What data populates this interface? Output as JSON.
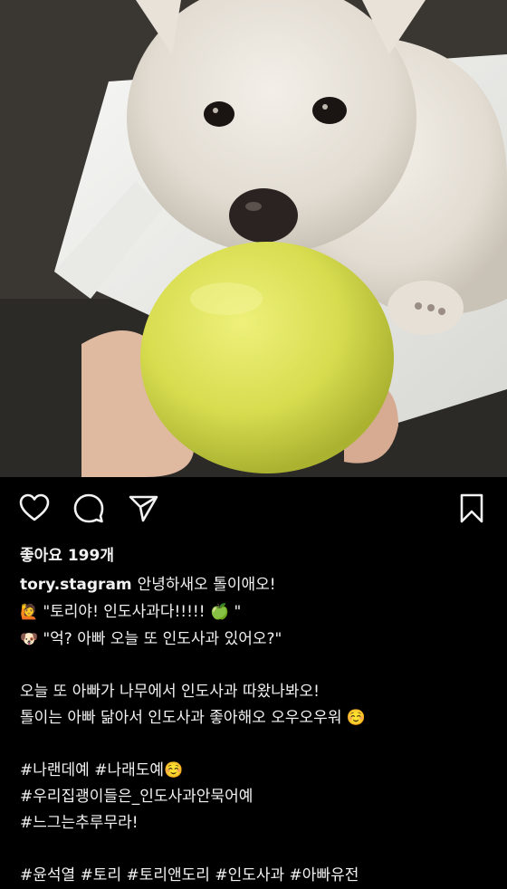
{
  "post": {
    "likes": "좋아요 199개",
    "username": "tory.stagram",
    "caption_lines": [
      {
        "text": "안녕하새오 톨이애오!"
      },
      {
        "emoji": "🙋",
        "text": " \"토리야! 인도사과다!!!!! 🍏 \""
      },
      {
        "emoji": "🐶",
        "text": " \"억? 아빠 오늘 또 인도사과 있어오?\""
      },
      {
        "text": ""
      },
      {
        "text": "오늘 또 아빠가 나무에서 인도사과 따왔나봐오!"
      },
      {
        "text": "톨이는 아빠 닮아서 인도사과 좋아해오 오우오우워 ☺️"
      },
      {
        "text": ""
      }
    ],
    "hashtag_lines": [
      "#나랜데예 #나래도예☺️",
      "#우리집괭이들은_인도사과안묵어예",
      "#느그는추루무라!",
      "",
      "#윤석열 #토리 #토리앤도리 #인도사과 #아빠유전"
    ]
  },
  "icons": {
    "like": "heart-outline-icon",
    "comment": "speech-bubble-icon",
    "share": "paper-plane-icon",
    "save": "bookmark-icon"
  },
  "colors": {
    "background": "#000000",
    "text": "#f2f2f2",
    "apple": "#d7dc4f"
  }
}
